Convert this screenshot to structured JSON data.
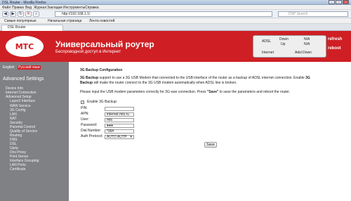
{
  "window": {
    "title": "DSL Router - Mozilla Firefox"
  },
  "menu": [
    "Файл",
    "Правка",
    "Вид",
    "Журнал",
    "Закладки",
    "Инструменты",
    "Справка"
  ],
  "nav": {
    "url": "http://192.168.1.1/",
    "search_placeholder": "DSP Search"
  },
  "bookmarks": [
    "Самые популярные",
    "Начальная страница",
    "Лента новостей"
  ],
  "tab": {
    "label": "DSL Router"
  },
  "header": {
    "logo": "МТС",
    "title": "Универсальный роутер",
    "subtitle": "Беспроводной доступ в Интернет",
    "status": {
      "adsl": "ADSL",
      "down": "Down",
      "up": "Up",
      "na1": "N/A",
      "na2": "N/A",
      "internet": "Internet",
      "adsl_down": "Adsl Down"
    },
    "refresh": "refresh",
    "reboot": "reboot"
  },
  "sidebar": {
    "lang_en": "English",
    "lang_ru": "Русский язык",
    "section": "Advanced Settings",
    "items": [
      {
        "label": "Device Info"
      },
      {
        "label": "Internet Connection"
      },
      {
        "label": "Advanced Setup"
      },
      {
        "label": "Layer2 Interface"
      },
      {
        "label": "WAN Service"
      },
      {
        "label": "3G Config"
      },
      {
        "label": "LAN"
      },
      {
        "label": "NAT"
      },
      {
        "label": "Security"
      },
      {
        "label": "Parental Control"
      },
      {
        "label": "Quality of Service"
      },
      {
        "label": "Routing"
      },
      {
        "label": "DNS"
      },
      {
        "label": "DSL"
      },
      {
        "label": "Upnp"
      },
      {
        "label": "Dns Proxy"
      },
      {
        "label": "Print Server"
      },
      {
        "label": "Interface Grouping"
      },
      {
        "label": "LAN Ports"
      },
      {
        "label": "Certificate"
      }
    ]
  },
  "main": {
    "heading": "3G Backup Configuration",
    "desc1a": "3G Backup",
    "desc1b": " support to use a 3G USB Modem that connected to the USB interface of the router as a backup of ADSL internet connection. Enable ",
    "desc1c": "3G",
    "desc2a": "Backup",
    "desc2b": " will make the router connect to the 3G USB modem automatically when ADSL line is broken.",
    "desc3a": "Please input the USB modem parameters correctly for 3G wan connection. Press ",
    "desc3b": "\"Save\"",
    "desc3c": " to save the parameters and reboot the router.",
    "enable_label": "Enable 3G Backup:",
    "fields": [
      {
        "label": "PIN:",
        "value": ""
      },
      {
        "label": "APN:",
        "value": "internet.mts.ru"
      },
      {
        "label": "User:",
        "value": "mts"
      },
      {
        "label": "Password:",
        "value": "●●●"
      },
      {
        "label": "Dial Number:",
        "value": "*99#"
      },
      {
        "label": "Auth Protocol:",
        "value": "AUTO AUTH"
      }
    ],
    "save": "Save"
  }
}
